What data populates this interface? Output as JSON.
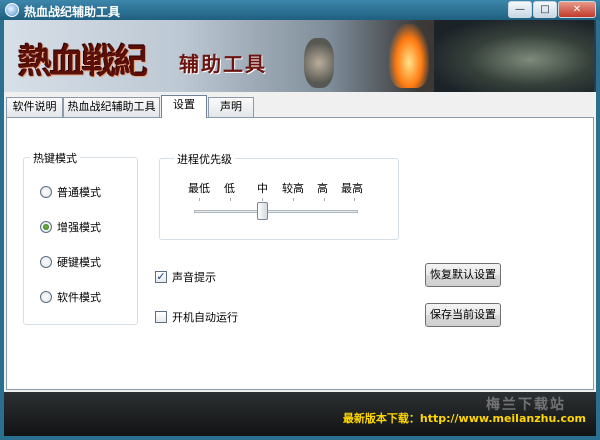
{
  "window": {
    "title": "热血战纪辅助工具",
    "controls": {
      "minimize": "—",
      "maximize": "□",
      "close": "✕"
    }
  },
  "banner": {
    "logo_text": "熱血戦紀",
    "subtitle": "辅助工具"
  },
  "tabs": [
    {
      "label": "软件说明",
      "active": false
    },
    {
      "label": "热血战纪辅助工具",
      "active": false
    },
    {
      "label": "设置",
      "active": true
    },
    {
      "label": "声明",
      "active": false
    }
  ],
  "hotkey_mode": {
    "legend": "热键模式",
    "options": [
      {
        "label": "普通模式",
        "checked": false
      },
      {
        "label": "增强模式",
        "checked": true
      },
      {
        "label": "硬键模式",
        "checked": false
      },
      {
        "label": "软件模式",
        "checked": false
      }
    ]
  },
  "process_priority": {
    "legend": "进程优先级",
    "levels": [
      "最低",
      "低",
      "中",
      "较高",
      "高",
      "最高"
    ],
    "selected_index": 2
  },
  "checkboxes": {
    "sound": {
      "label": "声音提示",
      "checked": true
    },
    "autostart": {
      "label": "开机自动运行",
      "checked": false
    }
  },
  "buttons": {
    "restore_defaults": "恢复默认设置",
    "save_settings": "保存当前设置"
  },
  "footer": {
    "download_text": "最新版本下载：http://www.meilanzhu.com",
    "watermark": "梅兰下载站"
  }
}
